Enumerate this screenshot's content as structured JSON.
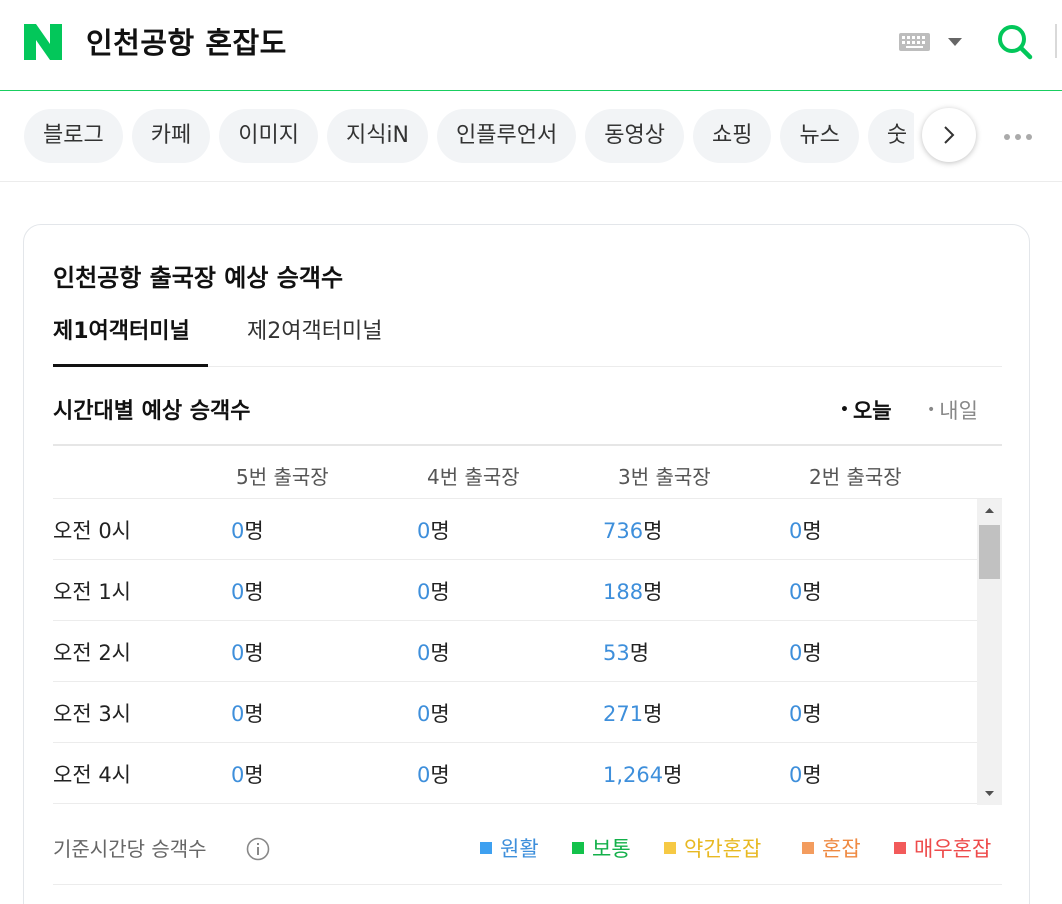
{
  "header": {
    "query": "인천공항 혼잡도"
  },
  "tabs": [
    "블로그",
    "카페",
    "이미지",
    "지식iN",
    "인플루언서",
    "동영상",
    "쇼핑",
    "뉴스",
    "숫"
  ],
  "card": {
    "title": "인천공항 출국장 예상 승객수",
    "terminal_tabs": [
      "제1여객터미널",
      "제2여객터미널"
    ],
    "section_title": "시간대별 예상 승객수",
    "day_today": "오늘",
    "day_tomorrow": "내일",
    "columns": [
      "5번 출국장",
      "4번 출국장",
      "3번 출국장",
      "2번 출국장"
    ],
    "unit": "명",
    "rows": [
      {
        "time": "오전 0시",
        "values": [
          "0",
          "0",
          "736",
          "0"
        ]
      },
      {
        "time": "오전 1시",
        "values": [
          "0",
          "0",
          "188",
          "0"
        ]
      },
      {
        "time": "오전 2시",
        "values": [
          "0",
          "0",
          "53",
          "0"
        ]
      },
      {
        "time": "오전 3시",
        "values": [
          "0",
          "0",
          "271",
          "0"
        ]
      },
      {
        "time": "오전 4시",
        "values": [
          "0",
          "0",
          "1,264",
          "0"
        ]
      }
    ],
    "basis_label": "기준시간당 승객수",
    "legend": [
      {
        "label": "원활",
        "color": "#3ea0f0"
      },
      {
        "label": "보통",
        "color": "#13c24b"
      },
      {
        "label": "약간혼잡",
        "color": "#f6c944"
      },
      {
        "label": "혼잡",
        "color": "#f39c5e"
      },
      {
        "label": "매우혼잡",
        "color": "#f25a5a"
      }
    ]
  },
  "colors": {
    "brand": "#03c75a",
    "value_blue": "#3e8fdb"
  }
}
